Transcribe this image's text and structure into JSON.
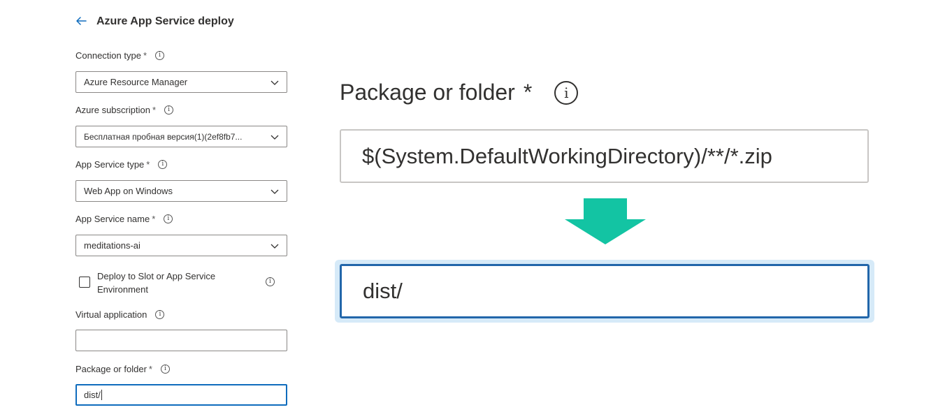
{
  "panel": {
    "title": "Azure App Service deploy"
  },
  "fields": {
    "connection_type": {
      "label": "Connection type",
      "required": "*",
      "value": "Azure Resource Manager"
    },
    "azure_subscription": {
      "label": "Azure subscription",
      "required": "*",
      "value": "Бесплатная пробная версия(1)(2ef8fb7..."
    },
    "app_service_type": {
      "label": "App Service type",
      "required": "*",
      "value": "Web App on Windows"
    },
    "app_service_name": {
      "label": "App Service name",
      "required": "*",
      "value": "meditations-ai"
    },
    "deploy_to_slot": {
      "label": "Deploy to Slot or App Service Environment"
    },
    "virtual_application": {
      "label": "Virtual application",
      "value": ""
    },
    "package_or_folder": {
      "label": "Package or folder",
      "required": "*",
      "value": "dist/"
    }
  },
  "zoom": {
    "label": "Package or folder",
    "required": "*",
    "old_value": "$(System.DefaultWorkingDirectory)/**/*.zip",
    "new_value": "dist/",
    "arrow_color": "#1abc9c"
  },
  "icons": {
    "back": "back-arrow-icon",
    "info_glyph": "i",
    "chevron": "chevron-down-icon",
    "arrow": "down-arrow-icon"
  }
}
